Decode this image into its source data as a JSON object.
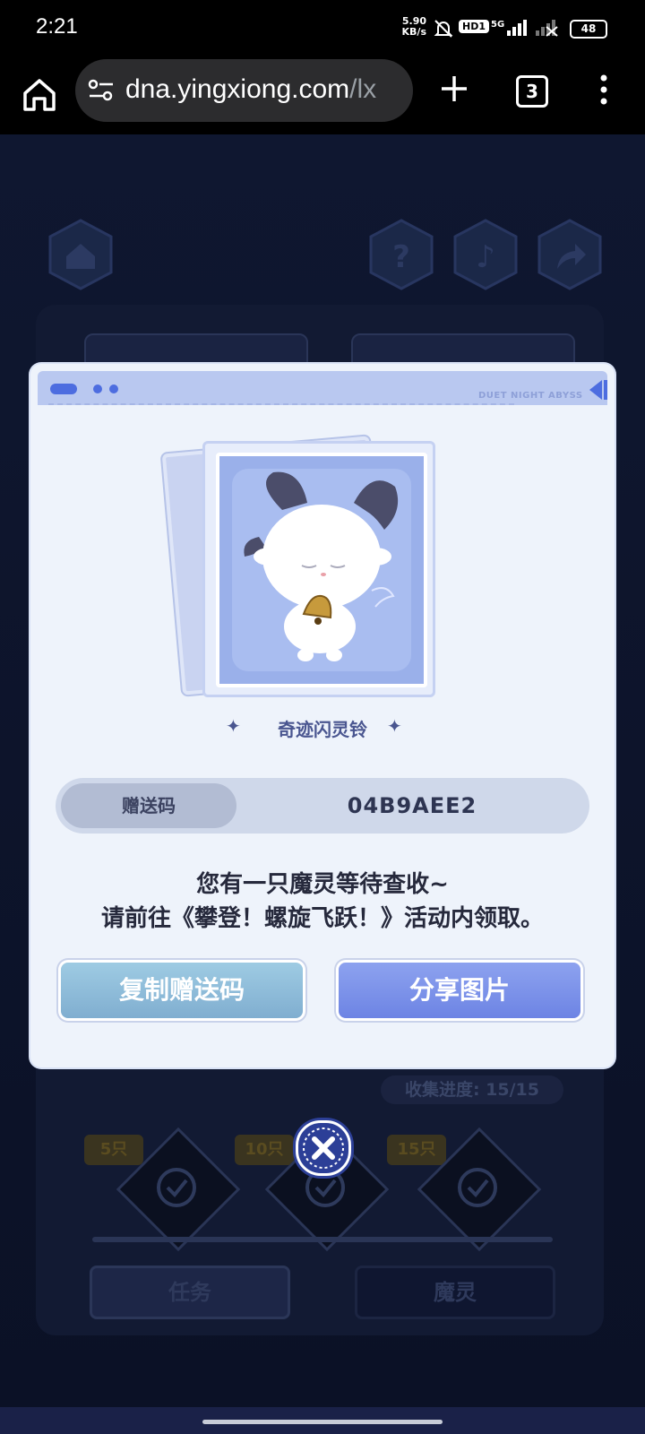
{
  "status_bar": {
    "time": "2:21",
    "speed_value": "5.90",
    "speed_unit": "KB/s",
    "hd": "HD1",
    "network": "5G",
    "battery": "48"
  },
  "browser": {
    "url_main": "dna.yingxiong.com",
    "url_tail": "/lx",
    "tab_count": "3"
  },
  "background": {
    "progress": "收集进度: 15/15",
    "milestones": [
      "5只",
      "10只",
      "15只"
    ],
    "tabs": [
      "任务",
      "魔灵"
    ]
  },
  "dialog": {
    "brand": "DUET NIGHT ABYSS",
    "reward_name": "奇迹闪灵铃",
    "code_label": "赠送码",
    "code_value": "04B9AEE2",
    "message_line1": "您有一只魔灵等待查收~",
    "message_line2": "请前往《攀登！螺旋飞跃！》活动内领取。",
    "copy_button": "复制赠送码",
    "share_button": "分享图片"
  },
  "icons": [
    "home-icon",
    "site-info-icon",
    "plus-icon",
    "tabs-icon",
    "more-vert-icon",
    "help-icon",
    "music-icon",
    "share-icon",
    "close-icon",
    "check-icon"
  ],
  "colors": {
    "accent": "#6d84e4",
    "copy_button": "#80aed0",
    "dialog_bg": "#eef3fb",
    "page_bg": "#0f1730"
  }
}
